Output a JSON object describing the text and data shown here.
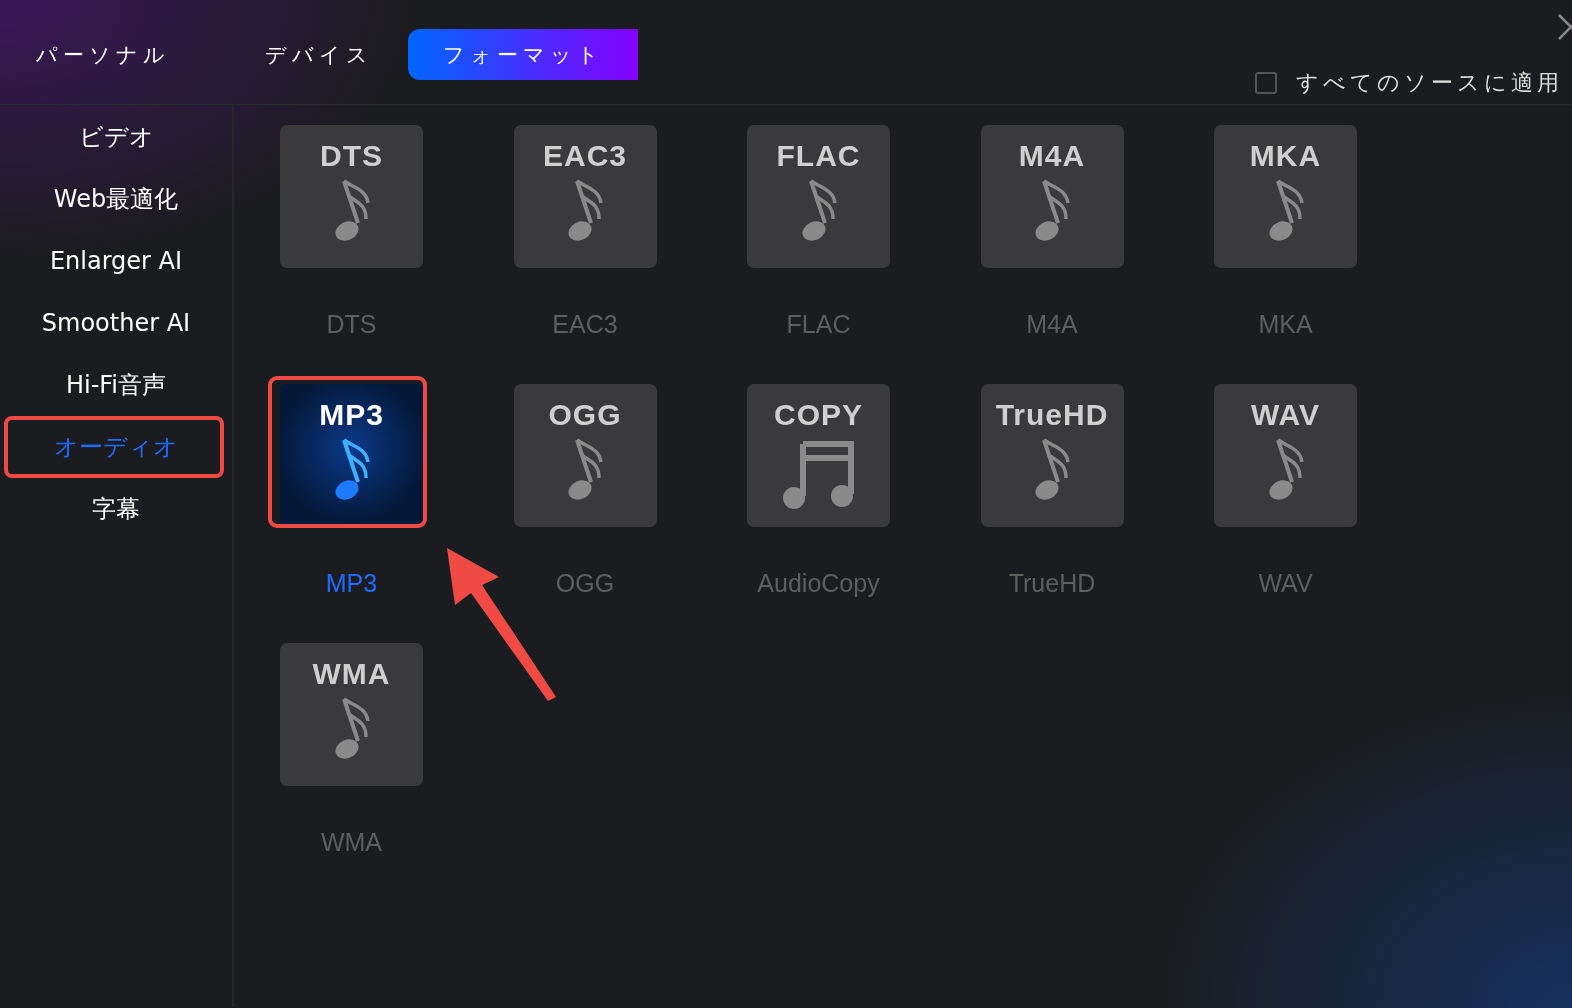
{
  "tabs": [
    {
      "label": "パーソナル",
      "selected": false
    },
    {
      "label": "デバイス",
      "selected": false
    },
    {
      "label": "フォーマット",
      "selected": true
    }
  ],
  "apply_all": {
    "label": "すべてのソースに適用",
    "checked": false
  },
  "sidebar": {
    "items": [
      {
        "label": "ビデオ",
        "selected": false,
        "highlighted": false
      },
      {
        "label": "Web最適化",
        "selected": false,
        "highlighted": false
      },
      {
        "label": "Enlarger AI",
        "selected": false,
        "highlighted": false
      },
      {
        "label": "Smoother AI",
        "selected": false,
        "highlighted": false
      },
      {
        "label": "Hi-Fi音声",
        "selected": false,
        "highlighted": false
      },
      {
        "label": "オーディオ",
        "selected": true,
        "highlighted": true
      },
      {
        "label": "字幕",
        "selected": false,
        "highlighted": false
      }
    ]
  },
  "formats": [
    {
      "badge": "DTS",
      "label": "DTS",
      "kind": "note",
      "selected": false,
      "highlighted": false
    },
    {
      "badge": "EAC3",
      "label": "EAC3",
      "kind": "note",
      "selected": false,
      "highlighted": false
    },
    {
      "badge": "FLAC",
      "label": "FLAC",
      "kind": "note",
      "selected": false,
      "highlighted": false
    },
    {
      "badge": "M4A",
      "label": "M4A",
      "kind": "note",
      "selected": false,
      "highlighted": false
    },
    {
      "badge": "MKA",
      "label": "MKA",
      "kind": "note",
      "selected": false,
      "highlighted": false
    },
    {
      "badge": "MP3",
      "label": "MP3",
      "kind": "note",
      "selected": true,
      "highlighted": true
    },
    {
      "badge": "OGG",
      "label": "OGG",
      "kind": "note",
      "selected": false,
      "highlighted": false
    },
    {
      "badge": "COPY",
      "label": "AudioCopy",
      "kind": "double-note",
      "selected": false,
      "highlighted": false
    },
    {
      "badge": "TrueHD",
      "label": "TrueHD",
      "kind": "note",
      "selected": false,
      "highlighted": false
    },
    {
      "badge": "WAV",
      "label": "WAV",
      "kind": "note",
      "selected": false,
      "highlighted": false
    },
    {
      "badge": "WMA",
      "label": "WMA",
      "kind": "note",
      "selected": false,
      "highlighted": false
    }
  ]
}
